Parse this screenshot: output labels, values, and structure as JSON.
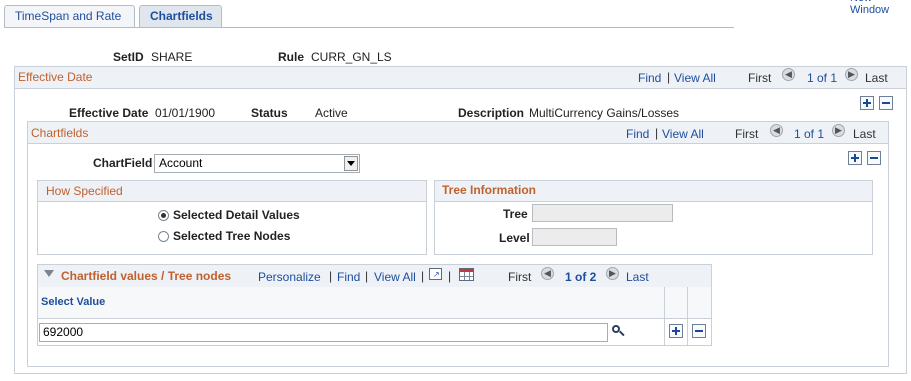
{
  "tabs": [
    {
      "label": "TimeSpan and Rate",
      "active": false
    },
    {
      "label": "Chartfields",
      "active": true
    }
  ],
  "top_right_link": "New Window",
  "header": {
    "setid_label": "SetID",
    "setid_value": "SHARE",
    "rule_label": "Rule",
    "rule_value": "CURR_GN_LS"
  },
  "effective_date_section": {
    "title": "Effective Date",
    "find": "Find",
    "view_all": "View All",
    "first": "First",
    "range": "1 of 1",
    "last": "Last",
    "effective_date_label": "Effective Date",
    "effective_date_value": "01/01/1900",
    "status_label": "Status",
    "status_value": "Active",
    "description_label": "Description",
    "description_value": "MultiCurrency Gains/Losses"
  },
  "chartfields_section": {
    "title": "Chartfields",
    "find": "Find",
    "view_all": "View All",
    "first": "First",
    "range": "1 of 1",
    "last": "Last",
    "chartfield_label": "ChartField",
    "chartfield_value": "Account"
  },
  "how_specified": {
    "title": "How Specified",
    "options": [
      {
        "label": "Selected Detail Values",
        "selected": true
      },
      {
        "label": "Selected Tree Nodes",
        "selected": false
      }
    ]
  },
  "tree_information": {
    "title": "Tree Information",
    "tree_label": "Tree",
    "tree_value": "",
    "level_label": "Level",
    "level_value": ""
  },
  "values_grid": {
    "title": "Chartfield values / Tree nodes",
    "personalize": "Personalize",
    "find": "Find",
    "view_all": "View All",
    "first": "First",
    "range": "1 of 2",
    "last": "Last",
    "column_header": "Select Value",
    "rows": [
      {
        "value": "692000"
      }
    ]
  },
  "colors": {
    "section_title": "#c0612f",
    "link": "#1d4e9e",
    "header_bg": "#eef1f5"
  }
}
